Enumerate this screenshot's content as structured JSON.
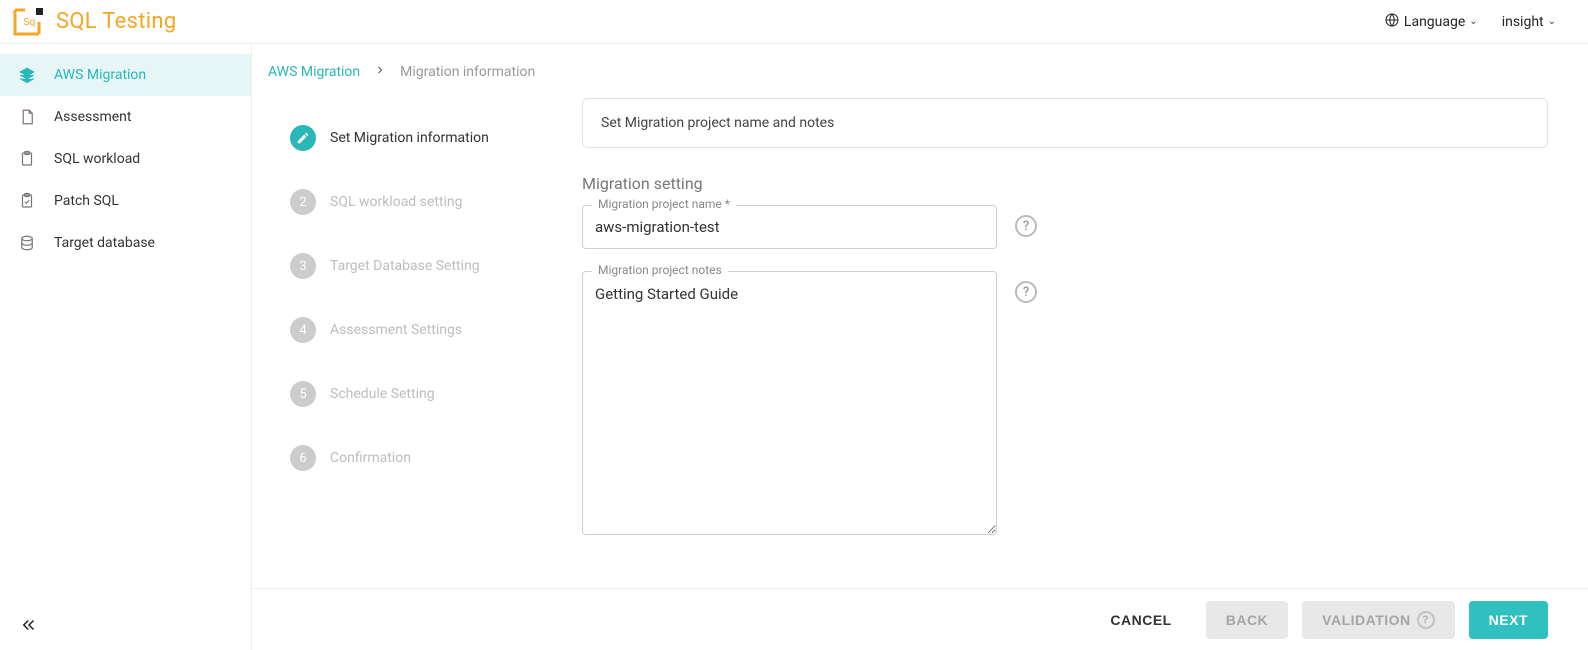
{
  "header": {
    "app_title": "SQL Testing",
    "language_label": "Language",
    "user_menu_label": "insight"
  },
  "sidebar": {
    "items": [
      {
        "label": "AWS Migration",
        "icon": "layers-icon",
        "active": true
      },
      {
        "label": "Assessment",
        "icon": "document-icon",
        "active": false
      },
      {
        "label": "SQL workload",
        "icon": "clipboard-icon",
        "active": false
      },
      {
        "label": "Patch SQL",
        "icon": "clipboard-check-icon",
        "active": false
      },
      {
        "label": "Target database",
        "icon": "database-icon",
        "active": false
      }
    ]
  },
  "breadcrumb": {
    "root": "AWS Migration",
    "current": "Migration information"
  },
  "stepper": {
    "steps": [
      {
        "num": "1",
        "label": "Set Migration information",
        "active": true,
        "icon": "pencil-icon"
      },
      {
        "num": "2",
        "label": "SQL workload setting",
        "active": false
      },
      {
        "num": "3",
        "label": "Target Database Setting",
        "active": false
      },
      {
        "num": "4",
        "label": "Assessment Settings",
        "active": false
      },
      {
        "num": "5",
        "label": "Schedule Setting",
        "active": false
      },
      {
        "num": "6",
        "label": "Confirmation",
        "active": false
      }
    ]
  },
  "form": {
    "banner": "Set Migration project name and notes",
    "section_title": "Migration setting",
    "name_label": "Migration project name *",
    "name_value": "aws-migration-test",
    "notes_label": "Migration project notes",
    "notes_value": "Getting Started Guide"
  },
  "footer": {
    "cancel": "CANCEL",
    "back": "BACK",
    "validation": "VALIDATION",
    "next": "NEXT"
  }
}
